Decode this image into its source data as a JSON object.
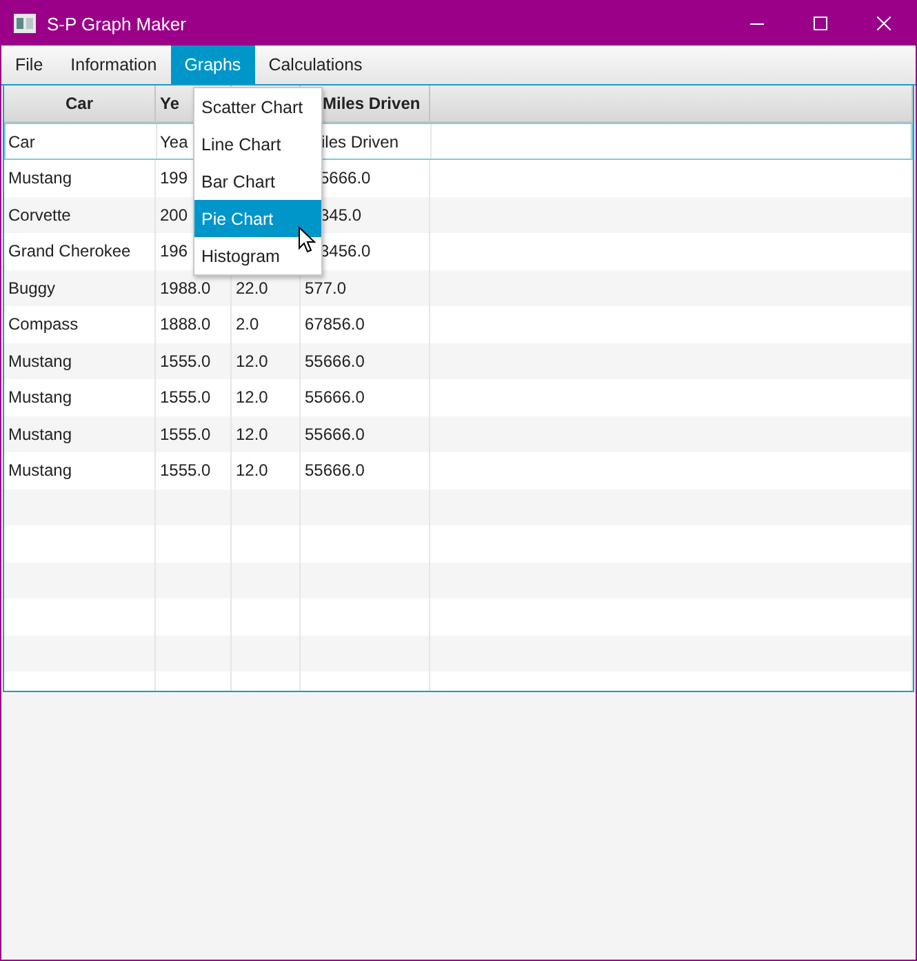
{
  "window": {
    "title": "S-P Graph Maker"
  },
  "menu_bar": [
    {
      "label": "File",
      "selected": false
    },
    {
      "label": "Information",
      "selected": false
    },
    {
      "label": "Graphs",
      "selected": true
    },
    {
      "label": "Calculations",
      "selected": false
    }
  ],
  "open_menu": {
    "items": [
      {
        "label": "Scatter Chart",
        "selected": false
      },
      {
        "label": "Line Chart",
        "selected": false
      },
      {
        "label": "Bar Chart",
        "selected": false
      },
      {
        "label": "Pie Chart",
        "selected": true
      },
      {
        "label": "Histogram",
        "selected": false
      }
    ]
  },
  "table": {
    "columns": [
      {
        "label": "Car",
        "covered": false
      },
      {
        "label": "Ye",
        "covered": false
      },
      {
        "label": "Miles Driven",
        "covered": true
      }
    ],
    "entry_row": [
      "Car",
      "Yea",
      "iles Driven"
    ],
    "rows": [
      {
        "cells": [
          "Mustang",
          "199",
          "5666.0"
        ],
        "covered": true
      },
      {
        "cells": [
          "Corvette",
          "200",
          "345.0"
        ],
        "covered": true
      },
      {
        "cells": [
          "Grand Cherokee",
          "196",
          "3456.0"
        ],
        "covered": true
      },
      {
        "cells": [
          "Buggy",
          "1988.0",
          "22.0",
          "577.0"
        ],
        "covered": false
      },
      {
        "cells": [
          "Compass",
          "1888.0",
          "2.0",
          "67856.0"
        ],
        "covered": false
      },
      {
        "cells": [
          "Mustang",
          "1555.0",
          "12.0",
          "55666.0"
        ],
        "covered": false
      },
      {
        "cells": [
          "Mustang",
          "1555.0",
          "12.0",
          "55666.0"
        ],
        "covered": false
      },
      {
        "cells": [
          "Mustang",
          "1555.0",
          "12.0",
          "55666.0"
        ],
        "covered": false
      },
      {
        "cells": [
          "Mustang",
          "1555.0",
          "12.0",
          "55666.0"
        ],
        "covered": false
      }
    ]
  }
}
